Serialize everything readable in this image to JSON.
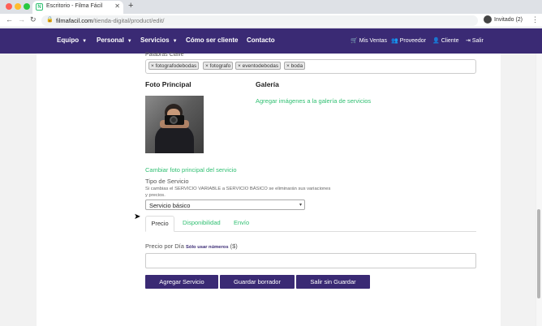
{
  "browser": {
    "tab_title": "Escritorio - Filma Fácil",
    "tab_favicon": "N",
    "url_domain": "filmafacil.com",
    "url_path": "/tienda-digital/product/edit/",
    "profile_label": "Invitado (2)"
  },
  "nav": {
    "items": [
      "Equipo",
      "Personal",
      "Servicios",
      "Cómo ser cliente",
      "Contacto"
    ],
    "right": [
      "Mis Ventas",
      "Proveedor",
      "Cliente",
      "Salir"
    ],
    "brand_color": "#3a2a74"
  },
  "form": {
    "keywords_label": "Palabras Clave",
    "tags": [
      "fotografodebodas",
      "fotografo",
      "eventodebodas",
      "boda"
    ],
    "foto_heading": "Foto Principal",
    "galeria_heading": "Galería",
    "galeria_link": "Agregar imágenes a la galería de servicios",
    "change_photo_link": "Cambiar foto principal del servicio",
    "tipo_label": "Tipo de Servicio",
    "tipo_help": "Si cambias el SERVICIO VARIABLE a SERVICIO BÁSICO se eliminarán sus variaciones y precios.",
    "tipo_value": "Servicio básico",
    "tabs": [
      "Precio",
      "Disponibilidad",
      "Envío"
    ],
    "precio_label": "Precio por Día",
    "precio_hint": "Sólo usar números",
    "precio_unit": "($)",
    "precio_value": "",
    "buttons": [
      "Agregar Servicio",
      "Guardar borrador",
      "Salir sin Guardar"
    ],
    "accent_color": "#2fbf71"
  }
}
